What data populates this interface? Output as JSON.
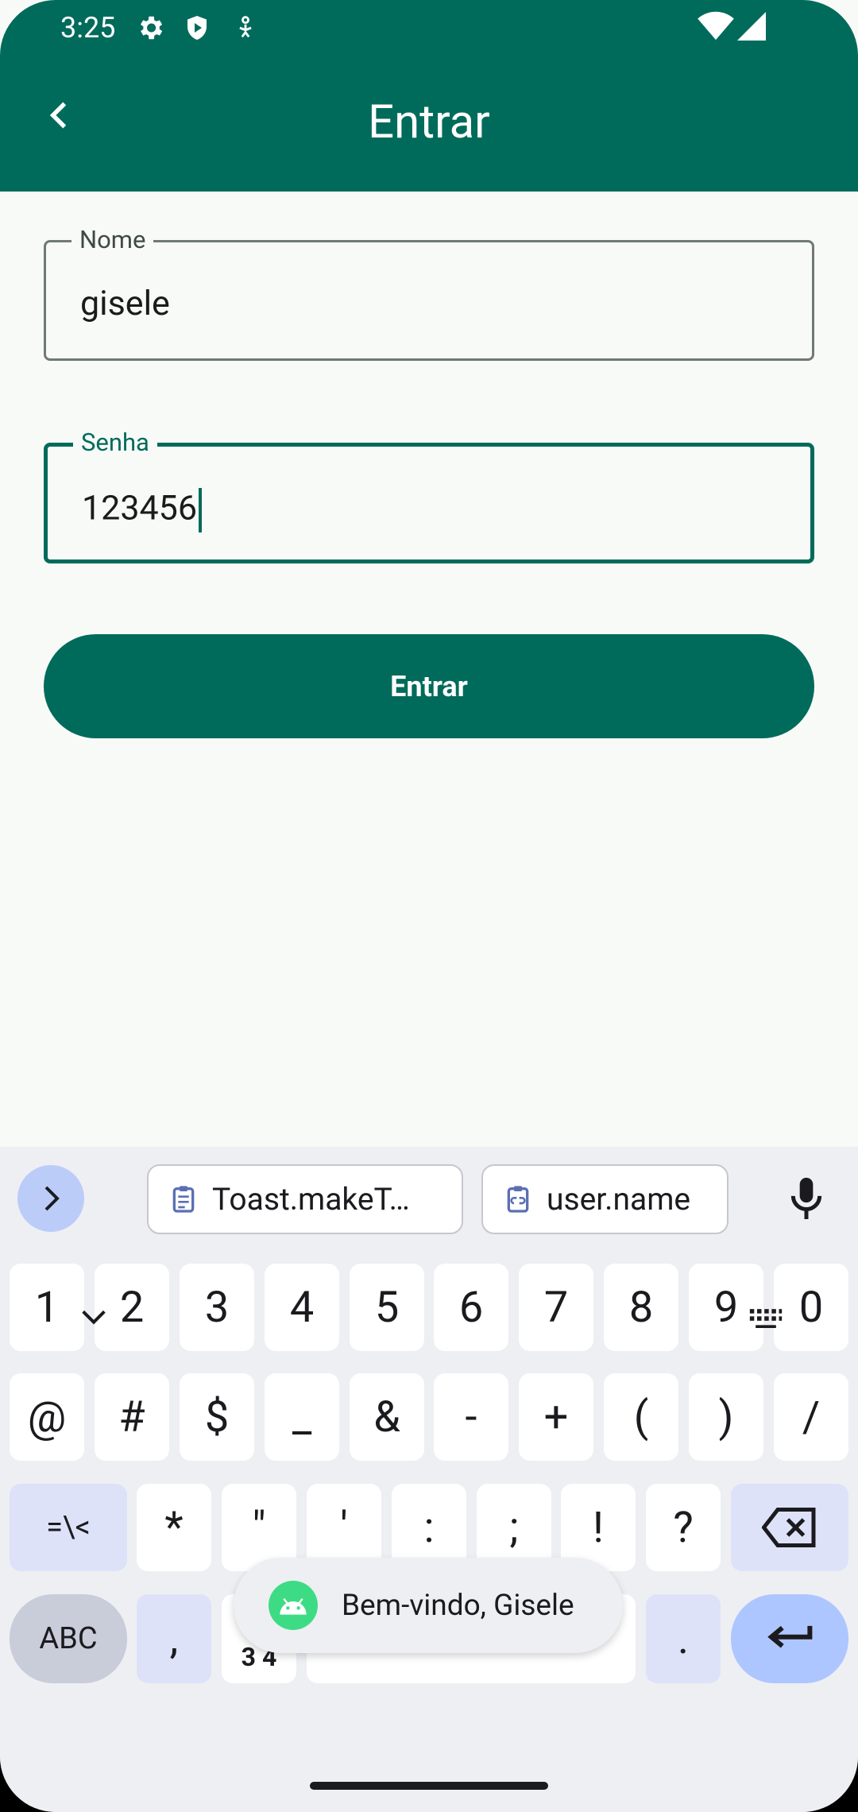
{
  "status_bar": {
    "time": "3:25"
  },
  "app_bar": {
    "title": "Entrar"
  },
  "form": {
    "name_label": "Nome",
    "name_value": "gisele",
    "password_label": "Senha",
    "password_value": "123456",
    "submit_label": "Entrar"
  },
  "keyboard": {
    "clipboard_chips": [
      "Toast.makeT…",
      "user.name"
    ],
    "row1": [
      "1",
      "2",
      "3",
      "4",
      "5",
      "6",
      "7",
      "8",
      "9",
      "0"
    ],
    "row2": [
      "@",
      "#",
      "$",
      "_",
      "&",
      "-",
      "+",
      "(",
      ")",
      "/"
    ],
    "row3_left": "=\\<",
    "row3": [
      "*",
      "\"",
      "'",
      ":",
      ";",
      "!",
      "?"
    ],
    "abc_label": "ABC",
    "comma": ",",
    "num_label": "3 4",
    "period": "."
  },
  "toast": {
    "message": "Bem-vindo, Gisele"
  },
  "colors": {
    "primary": "#006b5b",
    "background": "#f8faf7",
    "keyboard_bg": "#eeeff3"
  }
}
